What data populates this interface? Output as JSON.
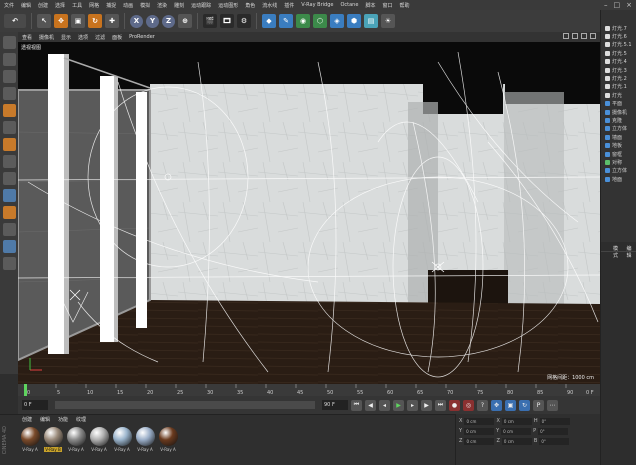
{
  "menubar": [
    "文件",
    "编辑",
    "创建",
    "选择",
    "工具",
    "网格",
    "捕捉",
    "动画",
    "模拟",
    "渲染",
    "雕刻",
    "运动跟踪",
    "运动图形",
    "角色",
    "流水线",
    "插件",
    "V-Ray Bridge",
    "Octane",
    "脚本",
    "窗口",
    "帮助"
  ],
  "toolbar": {
    "axis": [
      "X",
      "Y",
      "Z"
    ]
  },
  "viewport": {
    "menu": [
      "查看",
      "摄像机",
      "显示",
      "选项",
      "过滤",
      "面板",
      "ProRender"
    ],
    "label": "透视视图",
    "grid_readout": "网格间距：1000 cm"
  },
  "timeline": {
    "ticks": [
      "0",
      "5",
      "10",
      "15",
      "20",
      "25",
      "30",
      "35",
      "40",
      "45",
      "50",
      "55",
      "60",
      "65",
      "70",
      "75",
      "80",
      "85",
      "90"
    ],
    "end_label": "0 F"
  },
  "transport": {
    "start_field": "0 F",
    "end_field": "90 F"
  },
  "materials": {
    "tabs": [
      "创建",
      "编辑",
      "功能",
      "纹理"
    ],
    "items": [
      {
        "name": "V-Ray A",
        "color": "#7a4a2a",
        "selected": false
      },
      {
        "name": "V-Ray B",
        "color": "#9a8a7a",
        "selected": true
      },
      {
        "name": "V-Ray A",
        "color": "#8a8a8a",
        "selected": false
      },
      {
        "name": "V-Ray A",
        "color": "#b0b0b0",
        "selected": false
      },
      {
        "name": "V-Ray A",
        "color": "#9ab4cc",
        "selected": false
      },
      {
        "name": "V-Ray A",
        "color": "#9aaec8",
        "selected": false
      },
      {
        "name": "V-Ray A",
        "color": "#6a3a1e",
        "selected": false
      }
    ]
  },
  "coords": {
    "rows": [
      {
        "a": "X",
        "av": "0 cm",
        "b": "X",
        "bv": "0 cm",
        "c": "H",
        "cv": "0°"
      },
      {
        "a": "Y",
        "av": "0 cm",
        "b": "Y",
        "bv": "0 cm",
        "c": "P",
        "cv": "0°"
      },
      {
        "a": "Z",
        "av": "0 cm",
        "b": "Z",
        "bv": "0 cm",
        "c": "B",
        "cv": "0°"
      }
    ]
  },
  "objects": [
    {
      "name": "灯光.7",
      "icon": "light"
    },
    {
      "name": "灯光.6",
      "icon": "light"
    },
    {
      "name": "灯光.5.1",
      "icon": "light"
    },
    {
      "name": "灯光.5",
      "icon": "light"
    },
    {
      "name": "灯光.4",
      "icon": "light"
    },
    {
      "name": "灯光.3",
      "icon": "light"
    },
    {
      "name": "灯光.2",
      "icon": "light"
    },
    {
      "name": "灯光.1",
      "icon": "light"
    },
    {
      "name": "灯光",
      "icon": "light"
    },
    {
      "name": "平面",
      "icon": "geo"
    },
    {
      "name": "摄像机",
      "icon": "geo"
    },
    {
      "name": "克隆",
      "icon": "geo"
    },
    {
      "name": "立方体",
      "icon": "geo"
    },
    {
      "name": "墙面",
      "icon": "geo"
    },
    {
      "name": "地板",
      "icon": "geo"
    },
    {
      "name": "窗框",
      "icon": "geo"
    },
    {
      "name": "对称",
      "icon": "sym"
    },
    {
      "name": "立方体",
      "icon": "geo"
    },
    {
      "name": "地面",
      "icon": "geo"
    }
  ],
  "attributes": {
    "tabs": [
      "模式",
      "编辑"
    ]
  },
  "colors": {
    "orange": "#c8731e",
    "selected_material": "#c8a22a",
    "wall": "#d9dcdc"
  }
}
